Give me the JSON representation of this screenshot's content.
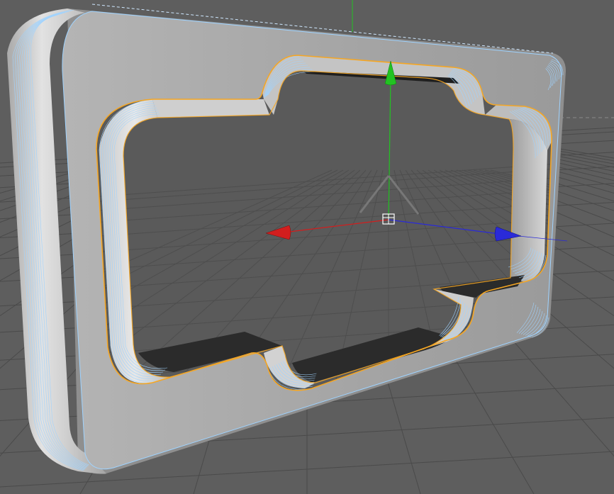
{
  "viewport": {
    "mode": "perspective",
    "background_color": "#5e5e5e",
    "grid_color": "#4a4a4a",
    "grid": true
  },
  "object": {
    "type": "beveled-frame",
    "selected": true,
    "selection_outline_color": "#f5a623",
    "wireframe_color": "#9fd3ff",
    "face_colors": [
      "#d9d9d9",
      "#b7b7b7",
      "#9c9c9c",
      "#8a8a8a"
    ],
    "inner_floor_color": "#2b2b2b"
  },
  "gizmo": {
    "x_axis_color": "#d21e1e",
    "y_axis_color": "#22c322",
    "z_axis_color": "#2a2ad8",
    "icons": [
      "x-axis-arrow-icon",
      "y-axis-arrow-icon",
      "z-axis-arrow-icon",
      "pivot-handle-icon"
    ]
  }
}
